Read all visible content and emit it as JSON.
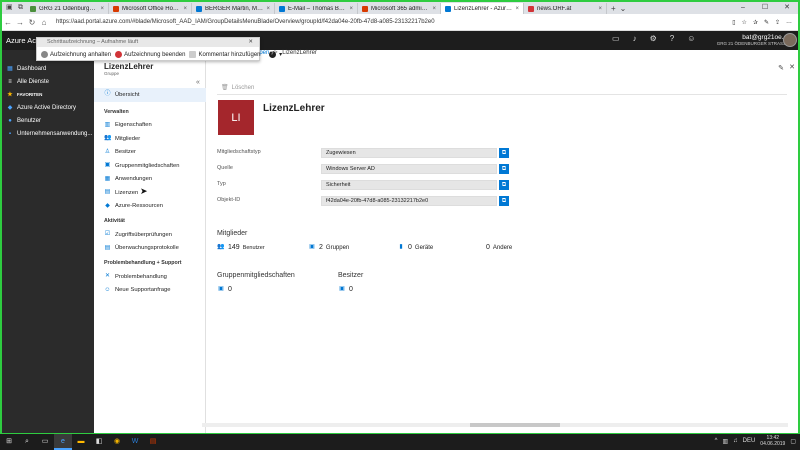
{
  "browser": {
    "tabs": [
      {
        "label": "GRG 21 Ödenburgerstraße",
        "color": "#4a8f3c"
      },
      {
        "label": "Microsoft Office Home",
        "color": "#d83b01"
      },
      {
        "label": "BERGER Martin, Martin, +1 |",
        "color": "#0078d4"
      },
      {
        "label": "E-Mail – Thomas Baldauf –",
        "color": "#0078d4"
      },
      {
        "label": "Microsoft 365 admin center",
        "color": "#d83b01"
      },
      {
        "label": "LizenzLehrer - Azure Ac",
        "color": "#0078d4"
      },
      {
        "label": "news.ORF.at",
        "color": "#d13438"
      }
    ],
    "active_tab": 5,
    "url": "https://aad.portal.azure.com/#blade/Microsoft_AAD_IAM/GroupDetailsMenuBlade/Overview/groupId/f42da04e-20fb-47d8-a085-23132217b2e0"
  },
  "azure": {
    "brand": "Azure Acti",
    "account_email": "bat@grg21oe.at",
    "account_org": "GRG 21 ÖDENBURGER STRASSE"
  },
  "recorder": {
    "title": "Schrittaufzeichnung – Aufnahme läuft",
    "pause": "Aufzeichnung anhalten",
    "stop_label": "Aufzeichnung beenden",
    "comment": "Kommentar hinzufügen",
    "help": "?"
  },
  "left_nav": [
    {
      "label": "Dashboard"
    },
    {
      "label": "Alle Dienste"
    },
    {
      "label": "FAVORITEN"
    },
    {
      "label": "Azure Active Directory"
    },
    {
      "label": "Benutzer"
    },
    {
      "label": "Unternehmensanwendung..."
    }
  ],
  "breadcrumb": {
    "prev": "ppen",
    "sep": ">",
    "current": "LizenzLehrer"
  },
  "blade": {
    "title": "LizenzLehrer",
    "subtitle": "Gruppe",
    "collapse": "«",
    "overview": "Übersicht",
    "sections": [
      {
        "title": "Verwalten",
        "items": [
          "Eigenschaften",
          "Mitglieder",
          "Besitzer",
          "Gruppenmitgliedschaften",
          "Anwendungen",
          "Lizenzen",
          "Azure-Ressourcen"
        ]
      },
      {
        "title": "Aktivität",
        "items": [
          "Zugriffsüberprüfungen",
          "Überwachungsprotokolle"
        ]
      },
      {
        "title": "Problembehandlung + Support",
        "items": [
          "Problembehandlung",
          "Neue Supportanfrage"
        ]
      }
    ]
  },
  "main": {
    "delete": "Löschen",
    "tile_text": "LI",
    "group_name": "LizenzLehrer",
    "properties": [
      {
        "label": "Mitgliedschaftstyp",
        "value": "Zugewiesen"
      },
      {
        "label": "Quelle",
        "value": "Windows Server AD"
      },
      {
        "label": "Typ",
        "value": "Sicherheit"
      },
      {
        "label": "Objekt-ID",
        "value": "f42da04e-20fb-47d8-a085-23132217b2e0"
      }
    ],
    "members_title": "Mitglieder",
    "members": {
      "users_count": "149",
      "users_label": "Benutzer",
      "groups_count": "2",
      "groups_label": "Gruppen",
      "devices_count": "0",
      "devices_label": "Geräte",
      "other_count": "0",
      "other_label": "Andere"
    },
    "group_memberships_title": "Gruppenmitgliedschaften",
    "group_memberships_count": "0",
    "owners_title": "Besitzer",
    "owners_count": "0"
  },
  "taskbar": {
    "lang": "DEU",
    "time": "13:42",
    "date": "04.06.2019"
  },
  "colors": {
    "accent": "#0078d4",
    "tile": "#a4262c",
    "border": "#2ecc40"
  }
}
